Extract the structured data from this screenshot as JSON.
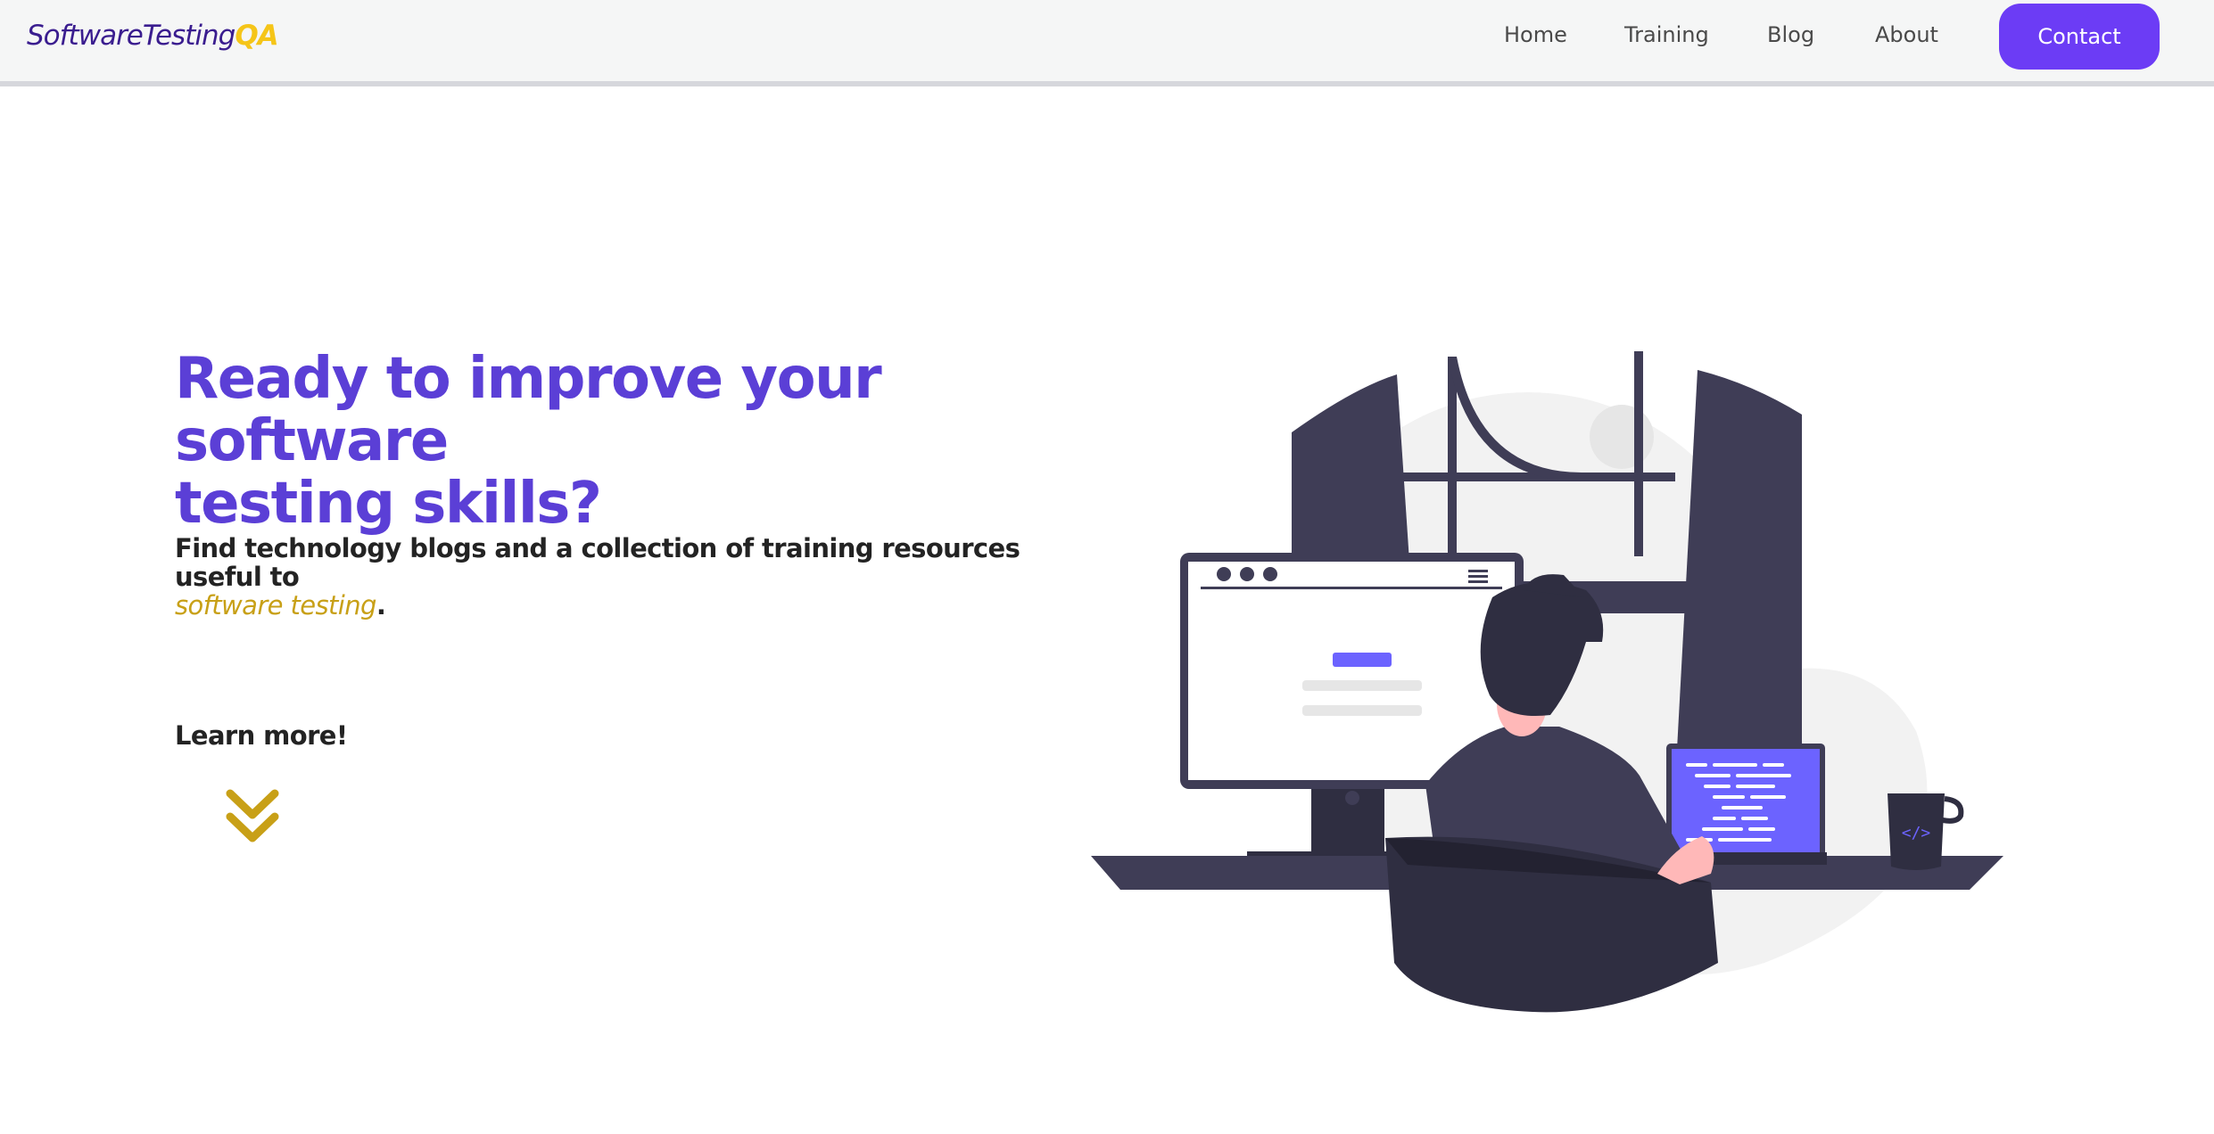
{
  "header": {
    "logo_main": "SoftwareTesting",
    "logo_accent": "QA",
    "nav": {
      "home": "Home",
      "training": "Training",
      "blog": "Blog",
      "about": "About"
    },
    "contact_label": "Contact"
  },
  "hero": {
    "title_line1": "Ready to improve your software",
    "title_line2": "testing skills?",
    "subtitle_text": "Find technology blogs and a collection of training resources useful to",
    "subtitle_highlight": "software testing",
    "subtitle_end": ".",
    "learn_more": "Learn more!"
  },
  "icons": {
    "scroll_down": "double-chevron-down-icon",
    "illustration": "developer-at-desk-illustration"
  },
  "colors": {
    "brand_purple": "#5b3fd6",
    "button_purple": "#6c3cf5",
    "accent_gold": "#c8a017",
    "logo_yellow": "#f5c518",
    "dark_navy": "#3f3d56"
  }
}
